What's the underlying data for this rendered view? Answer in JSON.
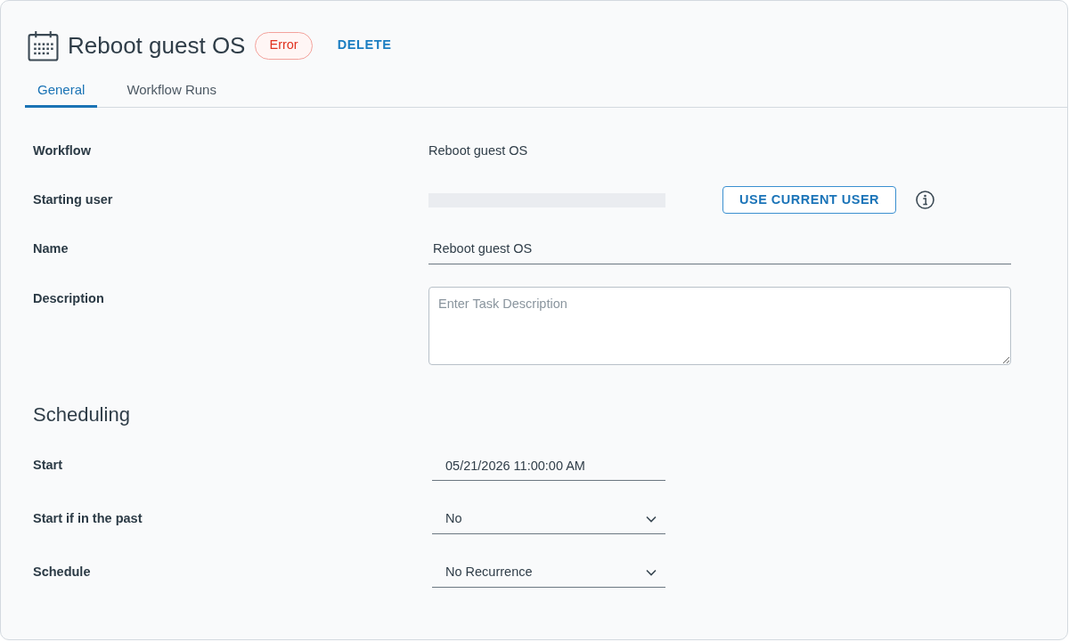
{
  "header": {
    "title": "Reboot guest OS",
    "status": {
      "label": "Error",
      "kind": "error"
    },
    "delete_link": "DELETE"
  },
  "tabs": [
    {
      "label": "General",
      "selected": true
    },
    {
      "label": "Workflow Runs",
      "selected": false
    }
  ],
  "fields": [
    {
      "kind": "text",
      "label": "Workflow",
      "value": "Reboot guest OS"
    },
    {
      "kind": "user",
      "label": "Starting user",
      "button": "USE CURRENT USER"
    },
    {
      "kind": "input",
      "label": "Name",
      "value": "Reboot guest OS"
    },
    {
      "kind": "textarea",
      "label": "Description",
      "placeholder": "Enter Task Description"
    }
  ],
  "scheduling": {
    "heading": "Scheduling",
    "fields": [
      {
        "kind": "input",
        "label": "Start",
        "value": "05/21/2026 11:00:00 AM"
      },
      {
        "kind": "select",
        "label": "Start if in the past",
        "value": "No"
      },
      {
        "kind": "select",
        "label": "Schedule",
        "value": "No Recurrence"
      }
    ]
  }
}
